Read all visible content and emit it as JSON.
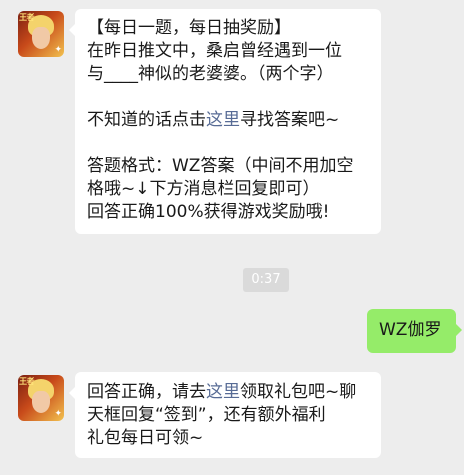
{
  "message1": {
    "line1": "【每日一题，每日抽奖励】",
    "line2": "在昨日推文中，桑启曾经遇到一位",
    "line3": "与____神似的老婆婆。（两个字）",
    "line4_pre": "不知道的话点击",
    "line4_link": "这里",
    "line4_post": "寻找答案吧~",
    "line5": "答题格式：WZ答案（中间不用加空",
    "line6": "格哦~↓下方消息栏回复即可）",
    "line7": "回答正确100%获得游戏奖励哦!"
  },
  "timestamp": "0:37",
  "reply": {
    "text": "WZ伽罗"
  },
  "message2": {
    "line1_pre": "回答正确，请去",
    "line1_link": "这里",
    "line1_post": "领取礼包吧~聊",
    "line2": "天框回复“签到”，还有额外福利",
    "line3": "礼包每日可领~"
  },
  "avatar": {
    "logo_text": "王者"
  },
  "colors": {
    "background": "#ededed",
    "link": "#576b95",
    "sent_bubble": "#95ec69"
  }
}
